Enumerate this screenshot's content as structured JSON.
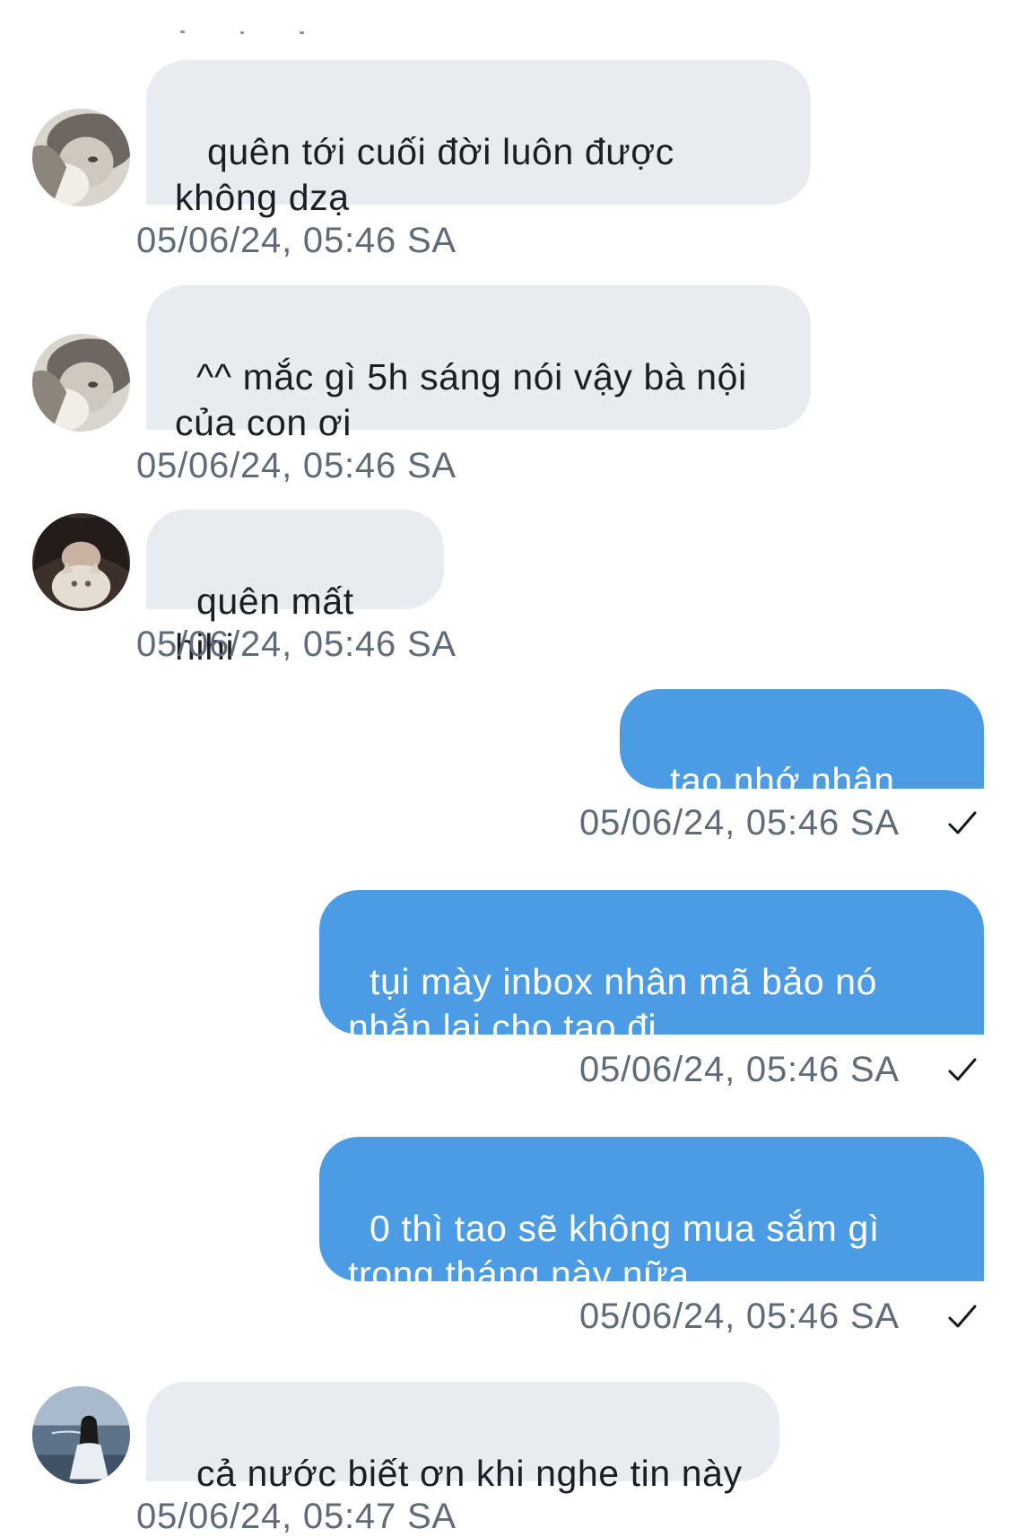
{
  "messages": [
    {
      "direction": "in",
      "avatar": "avatar-blurry-girl",
      "lines": [
        " quên tới cuối đời luôn được",
        "không dzạ"
      ],
      "time": "05/06/24, 05:46 SA"
    },
    {
      "direction": "in",
      "avatar": "avatar-blurry-girl",
      "lines": [
        "^^ mắc gì 5h sáng nói vậy bà nội",
        "của con ơi"
      ],
      "time": "05/06/24, 05:46 SA"
    },
    {
      "direction": "in",
      "avatar": "avatar-girl-with-cat",
      "lines": [
        "quên mất hihi"
      ],
      "time": "05/06/24, 05:46 SA"
    },
    {
      "direction": "out",
      "lines": [
        "tao nhớ nhân mã"
      ],
      "time": "05/06/24, 05:46 SA",
      "status": "check-icon"
    },
    {
      "direction": "out",
      "lines": [
        "tụi mày inbox nhân mã bảo nó",
        "nhắn lại cho tao đi"
      ],
      "time": "05/06/24, 05:46 SA",
      "status": "check-icon"
    },
    {
      "direction": "out",
      "lines": [
        "0 thì tao sẽ không mua sắm gì",
        "trong tháng này nữa"
      ],
      "time": "05/06/24, 05:46 SA",
      "status": "check-icon"
    },
    {
      "direction": "in",
      "avatar": "avatar-girl-at-beach",
      "lines": [
        "cả nước biết ơn khi nghe tin này"
      ],
      "time": "05/06/24, 05:47 SA"
    }
  ],
  "colors": {
    "incoming_bubble": "#e8ebef",
    "outgoing_bubble": "#4c9be5",
    "timestamp": "#5f6b78"
  }
}
